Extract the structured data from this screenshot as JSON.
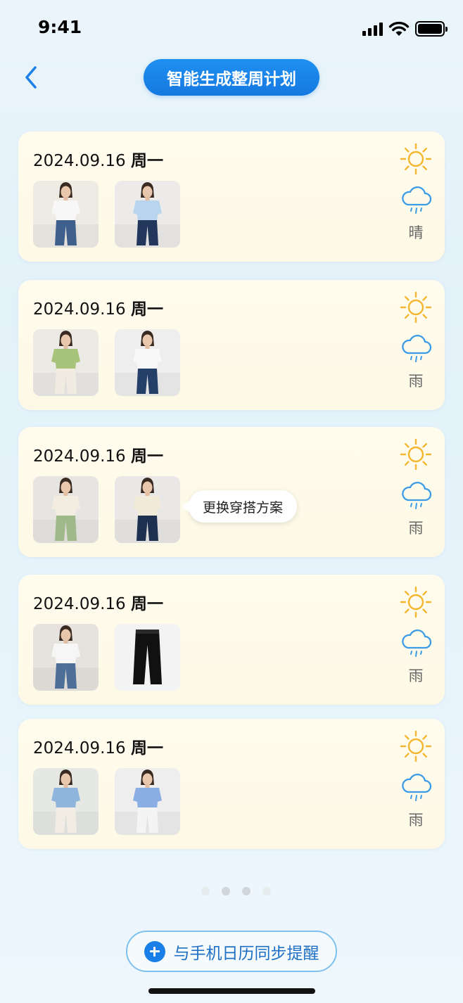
{
  "status_bar": {
    "time": "9:41"
  },
  "header": {
    "title": "智能生成整周计划"
  },
  "days": [
    {
      "date": "2024.09.16",
      "weekday": "周一",
      "weather": "晴",
      "outfits": [
        {
          "top": "#f7f7f7",
          "bottom": "#3f5f8d",
          "bg": "#eeeae4"
        },
        {
          "top": "#b9d4ee",
          "bottom": "#23375d",
          "bg": "#ecebea"
        }
      ]
    },
    {
      "date": "2024.09.16",
      "weekday": "周一",
      "weather": "雨",
      "outfits": [
        {
          "top": "#a7c47a",
          "bottom": "#f1ece2",
          "bg": "#eceae5"
        },
        {
          "top": "#f8f8f8",
          "bottom": "#243f68",
          "bg": "#eeeeee"
        }
      ]
    },
    {
      "date": "2024.09.16",
      "weekday": "周一",
      "weather": "雨",
      "outfits": [
        {
          "top": "#f2ede0",
          "bottom": "#9fb98a",
          "bg": "#e7e5e1"
        },
        {
          "top": "#f1ead8",
          "bottom": "#1e3050",
          "bg": "#e9e8e6"
        }
      ]
    },
    {
      "date": "2024.09.16",
      "weekday": "周一",
      "weather": "雨",
      "outfits": [
        {
          "top": "#f6f6f6",
          "bottom": "#4d6f98",
          "bg": "#e6e3de"
        },
        {
          "top": "#111111",
          "bottom": "#111111",
          "bg": "#f3f3f3",
          "item": "pants"
        }
      ]
    },
    {
      "date": "2024.09.16",
      "weekday": "周一",
      "weather": "雨",
      "outfits": [
        {
          "top": "#8fb5dc",
          "bottom": "#f1ede4",
          "bg": "#e6e9e3"
        },
        {
          "top": "#8aaee4",
          "bottom": "#f4f4f4",
          "bg": "#eeeeee"
        }
      ]
    }
  ],
  "tooltip": {
    "text": "更换穿搭方案"
  },
  "pager": {
    "count": 4,
    "active": 2
  },
  "sync_button": {
    "label": "与手机日历同步提醒"
  },
  "colors": {
    "accent": "#1a7fe6",
    "sun": "#f4b62e",
    "rain": "#3c9be6",
    "card": "#fffcee"
  }
}
